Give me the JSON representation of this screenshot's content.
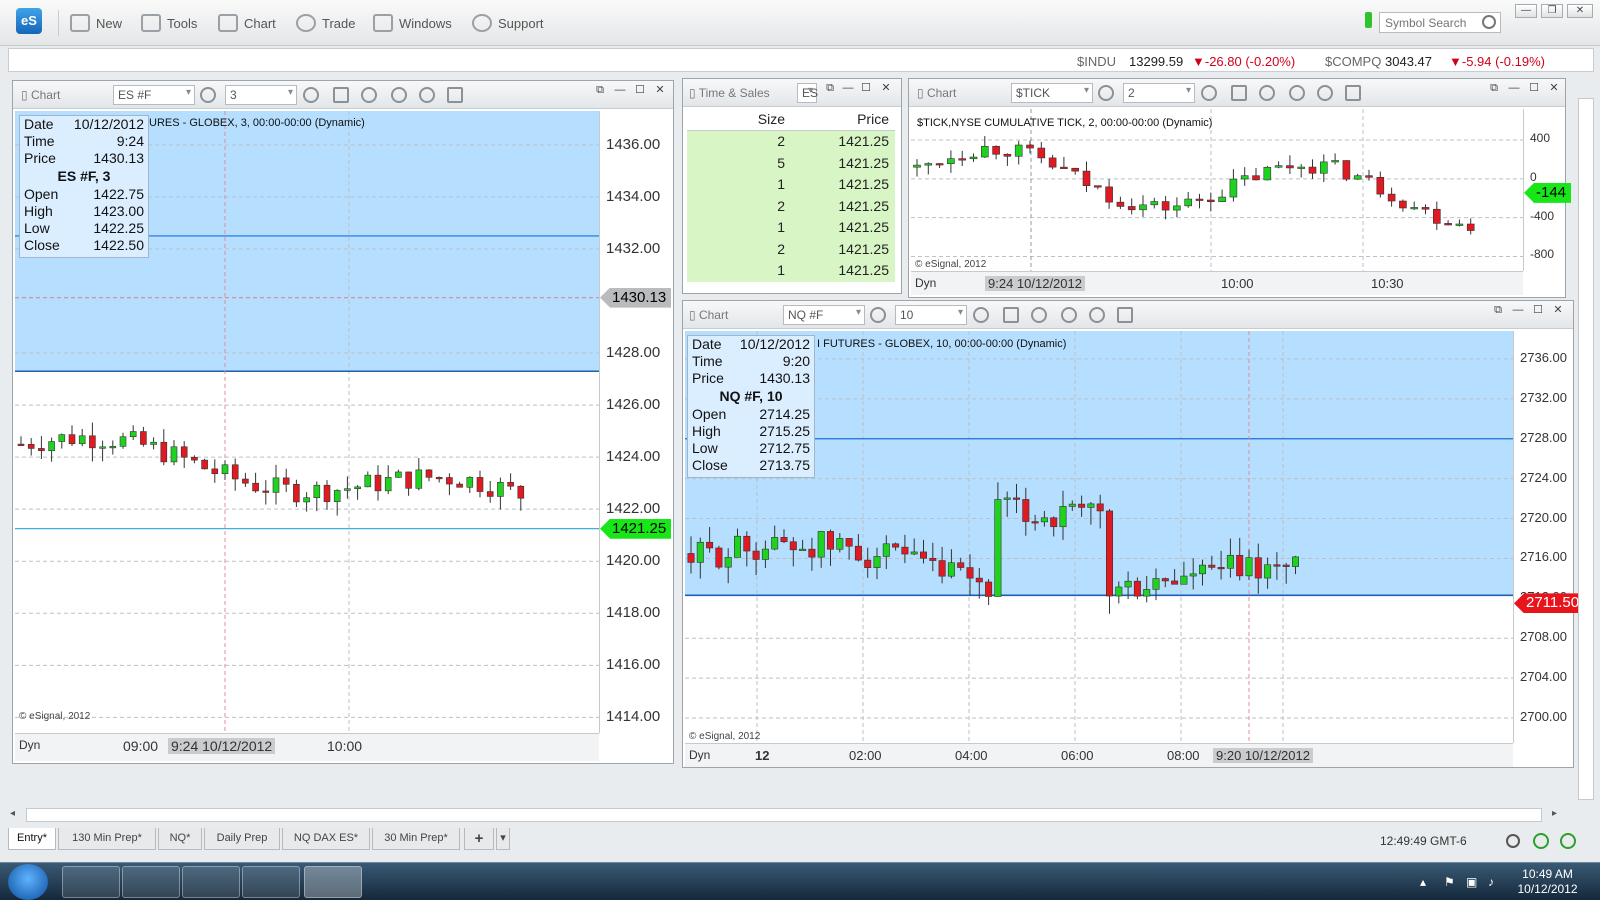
{
  "toolbar": {
    "logo": "eS",
    "buttons": [
      {
        "label": "New",
        "icon": "new-icon"
      },
      {
        "label": "Tools",
        "icon": "tools-icon"
      },
      {
        "label": "Chart",
        "icon": "chart-icon"
      },
      {
        "label": "Trade",
        "icon": "trade-icon"
      },
      {
        "label": "Windows",
        "icon": "windows-icon"
      },
      {
        "label": "Support",
        "icon": "support-icon"
      }
    ],
    "search_placeholder": "Symbol Search"
  },
  "quotes": [
    {
      "symbol": "$INDU",
      "last": "13299.59",
      "change": "▼-26.80 (-0.20%)"
    },
    {
      "symbol": "$COMPQ",
      "last": "3043.47",
      "change": "▼-5.94 (-0.19%)"
    }
  ],
  "colors": {
    "up": "#1fd21f",
    "down": "#e01a22",
    "band": "#a8d8ff",
    "accent": "#1e6fd9"
  },
  "es_chart": {
    "title": "Chart",
    "symbol": "ES #F",
    "interval": "3",
    "caption": "URES - GLOBEX, 3, 00:00-00:00 (Dynamic)",
    "info": {
      "date_label": "Date",
      "date": "10/12/2012",
      "time_label": "Time",
      "time": "9:24",
      "price_label": "Price",
      "price": "1430.13",
      "heading": "ES #F, 3",
      "open_label": "Open",
      "open": "1422.75",
      "high_label": "High",
      "high": "1423.00",
      "low_label": "Low",
      "low": "1422.25",
      "close_label": "Close",
      "close": "1422.50"
    },
    "y_labels": [
      "1436.00",
      "1434.00",
      "1432.00",
      "1430.13",
      "1428.00",
      "1426.00",
      "1424.00",
      "1422.00",
      "1421.25",
      "1420.00",
      "1418.00",
      "1416.00",
      "1414.00"
    ],
    "cursor_price": "1430.13",
    "last_price": "1421.25",
    "x_labels": [
      "09:00",
      "9:24 10/12/2012",
      "10:00"
    ],
    "dyn": "Dyn",
    "copyright": "© eSignal, 2012"
  },
  "time_sales": {
    "title": "Time & Sales",
    "symbol": "ES",
    "headers": [
      "Size",
      "Price"
    ],
    "rows": [
      [
        "2",
        "1421.25"
      ],
      [
        "5",
        "1421.25"
      ],
      [
        "1",
        "1421.25"
      ],
      [
        "2",
        "1421.25"
      ],
      [
        "1",
        "1421.25"
      ],
      [
        "2",
        "1421.25"
      ],
      [
        "1",
        "1421.25"
      ]
    ]
  },
  "tick_chart": {
    "title": "Chart",
    "symbol": "$TICK",
    "interval": "2",
    "caption": "$TICK,NYSE CUMULATIVE TICK, 2, 00:00-00:00 (Dynamic)",
    "y_labels": [
      "400",
      "0",
      "-400",
      "-800"
    ],
    "last_price": "-144",
    "x_labels": [
      "9:24 10/12/2012",
      "10:00",
      "10:30"
    ],
    "dyn": "Dyn",
    "copyright": "© eSignal, 2012"
  },
  "nq_chart": {
    "title": "Chart",
    "symbol": "NQ #F",
    "interval": "10",
    "caption": "I FUTURES - GLOBEX, 10, 00:00-00:00 (Dynamic)",
    "info": {
      "date_label": "Date",
      "date": "10/12/2012",
      "time_label": "Time",
      "time": "9:20",
      "price_label": "Price",
      "price": "1430.13",
      "heading": "NQ #F, 10",
      "open_label": "Open",
      "open": "2714.25",
      "high_label": "High",
      "high": "2715.25",
      "low_label": "Low",
      "low": "2712.75",
      "close_label": "Close",
      "close": "2713.75"
    },
    "y_labels": [
      "2736.00",
      "2732.00",
      "2728.00",
      "2724.00",
      "2720.00",
      "2716.00",
      "2712.00",
      "2708.00",
      "2704.00",
      "2700.00"
    ],
    "last_price": "2711.50",
    "x_labels": [
      "12",
      "02:00",
      "04:00",
      "06:00",
      "08:00",
      "9:20 10/12/2012"
    ],
    "dyn": "Dyn",
    "copyright": "© eSignal, 2012"
  },
  "tabs": [
    "Entry*",
    "130 Min Prep*",
    "NQ*",
    "Daily Prep",
    "NQ DAX ES*",
    "30 Min Prep*",
    "+",
    "▾"
  ],
  "status": {
    "time": "12:49:49 GMT-6"
  },
  "taskbar": {
    "clock_time": "10:49 AM",
    "clock_date": "10/12/2012"
  }
}
